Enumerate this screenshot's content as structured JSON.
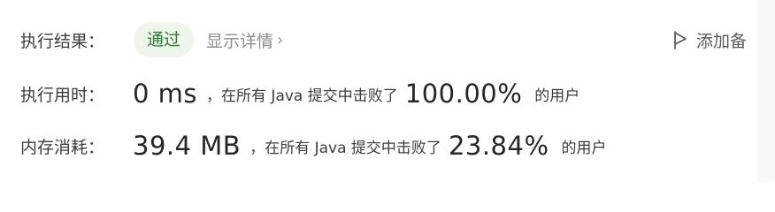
{
  "result": {
    "label": "执行结果：",
    "status": "通过",
    "details_link": "显示详情",
    "details_chevron": "›"
  },
  "note_button": {
    "icon": "flag-outline-icon",
    "label": "添加备"
  },
  "runtime": {
    "label": "执行用时：",
    "value": "0 ms",
    "middle_text": "，在所有 Java 提交中击败了",
    "percent": "100.00%",
    "suffix": "的用户"
  },
  "memory": {
    "label": "内存消耗：",
    "value": "39.4 MB",
    "middle_text": "，在所有 Java 提交中击败了",
    "percent": "23.84%",
    "suffix": "的用户"
  },
  "colors": {
    "pass_text": "#2e7d32",
    "pass_bg": "#eef5ea",
    "muted": "#8c8c8c"
  }
}
